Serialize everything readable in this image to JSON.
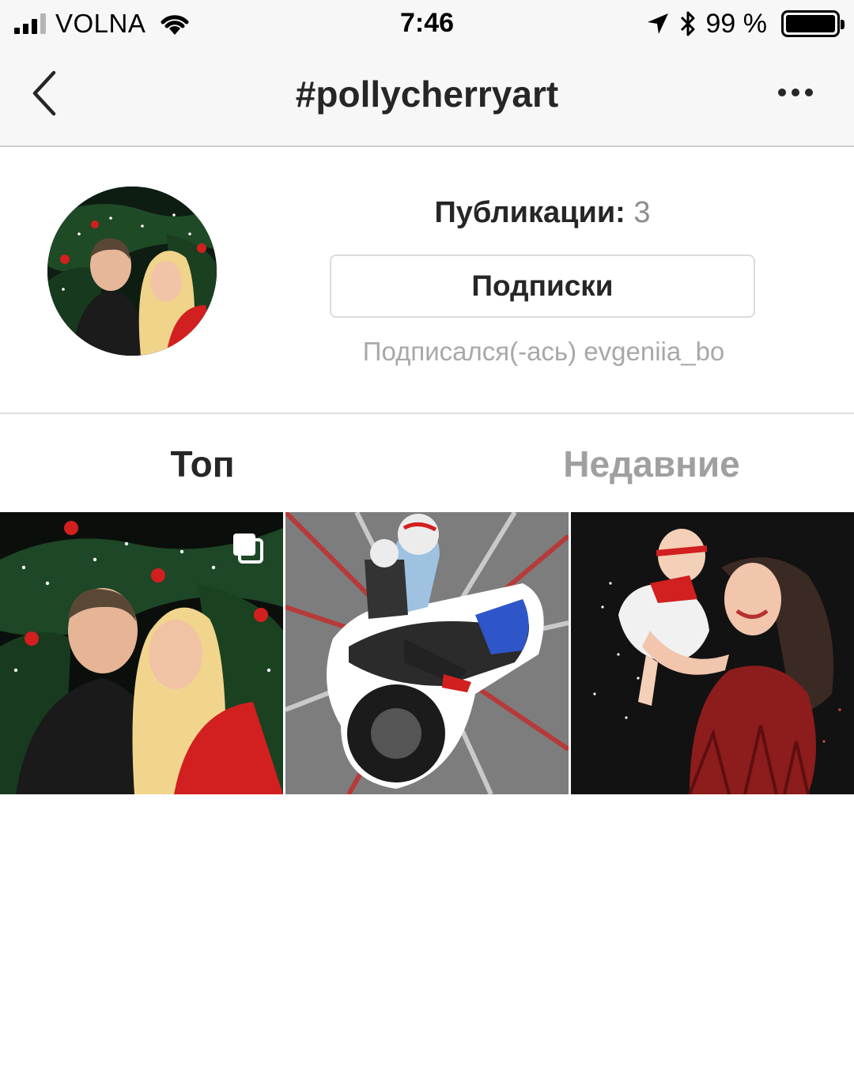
{
  "status_bar": {
    "carrier": "VOLNA",
    "time": "7:46",
    "battery": "99 %",
    "battery_level": 0.99
  },
  "nav": {
    "title": "#pollycherryart"
  },
  "header": {
    "posts_label": "Публикации:",
    "posts_value": "3",
    "follow_button": "Подписки",
    "followed_by": "Подписался(-ась) evgeniia_bo"
  },
  "tabs": {
    "top": "Топ",
    "recent": "Недавние"
  },
  "colors": {
    "accent_red": "#d21f1f",
    "text_primary": "#262626",
    "text_secondary": "#8e8e8e"
  }
}
